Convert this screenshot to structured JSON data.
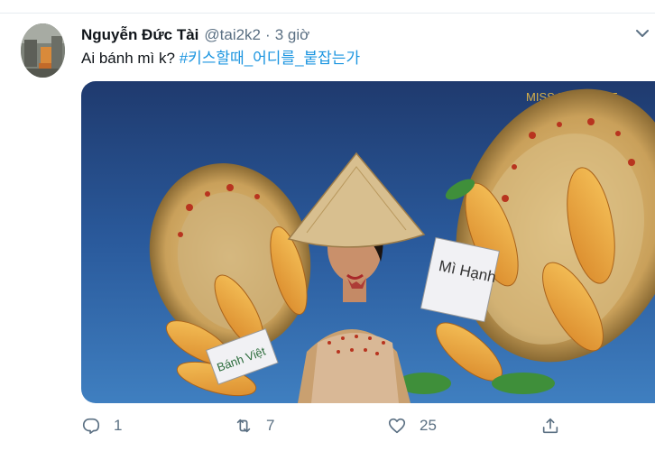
{
  "tweet": {
    "author_name": "Nguyễn Đức Tài",
    "author_handle": "@tai2k2",
    "separator": "·",
    "time": "3 giờ",
    "text": "Ai bánh mì k?",
    "hashtag": "#키스할때_어디를_붙잡는가",
    "media_watermark": "MISS UNIVERSE",
    "media_sign_1": "Mì Hạnh",
    "media_sign_2": "Bánh Việt"
  },
  "actions": {
    "reply_count": "1",
    "retweet_count": "7",
    "like_count": "25"
  },
  "colors": {
    "accent": "#1b95e0",
    "muted": "#5b7083",
    "text": "#0f1419"
  },
  "icons": [
    "chevron-down-icon",
    "reply-icon",
    "retweet-icon",
    "like-icon",
    "share-icon"
  ]
}
